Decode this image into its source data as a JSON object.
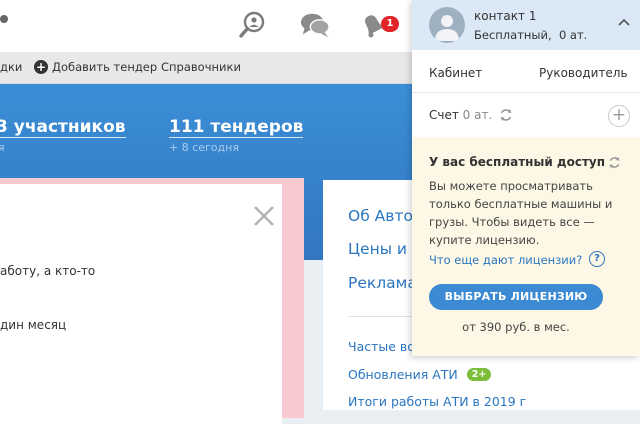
{
  "topbar": {
    "icons": [
      "search-person-icon",
      "chat-icon",
      "bell-icon"
    ],
    "notification_count": "1"
  },
  "menu": {
    "item_partial": "дки",
    "add_tender": "Добавить тендер",
    "directories": "Справочники"
  },
  "stats": {
    "participants": "3 участников",
    "participants_sub": "я",
    "tenders": "111 тендеров",
    "tenders_sub": "+ 8 сегодня"
  },
  "left_card": {
    "line1": "аботу, а кто-то",
    "line2": "дин месяц"
  },
  "right_card": {
    "links": [
      "Об Авто",
      "Цены и",
      "Реклама"
    ],
    "small_links": [
      "Частые во",
      "Обновления АТИ"
    ],
    "updates_badge": "2+",
    "last_link": "Итоги работы АТИ в 2019 г"
  },
  "account": {
    "name": "контакт 1",
    "plan": "Бесплатный,",
    "plan_balance": "0 ат.",
    "cabinet": "Кабинет",
    "role": "Руководитель",
    "account_label": "Счет",
    "account_value": "0 ат."
  },
  "promo": {
    "title": "У вас бесплатный доступ",
    "text": [
      "Вы можете просматривать",
      "только бесплатные машины и",
      "грузы. Чтобы видеть все —",
      "купите лицензию."
    ],
    "link": "Что еще дают лицензии?",
    "button": "ВЫБРАТЬ ЛИЦЕНЗИЮ",
    "price": "от 390 руб. в мес."
  },
  "colors": {
    "accent": "#3d8ad4",
    "hero": "#3276c2",
    "badge_red": "#e0242a",
    "badge_green": "#7cbd3a",
    "promo_bg": "#fdf7e5"
  }
}
